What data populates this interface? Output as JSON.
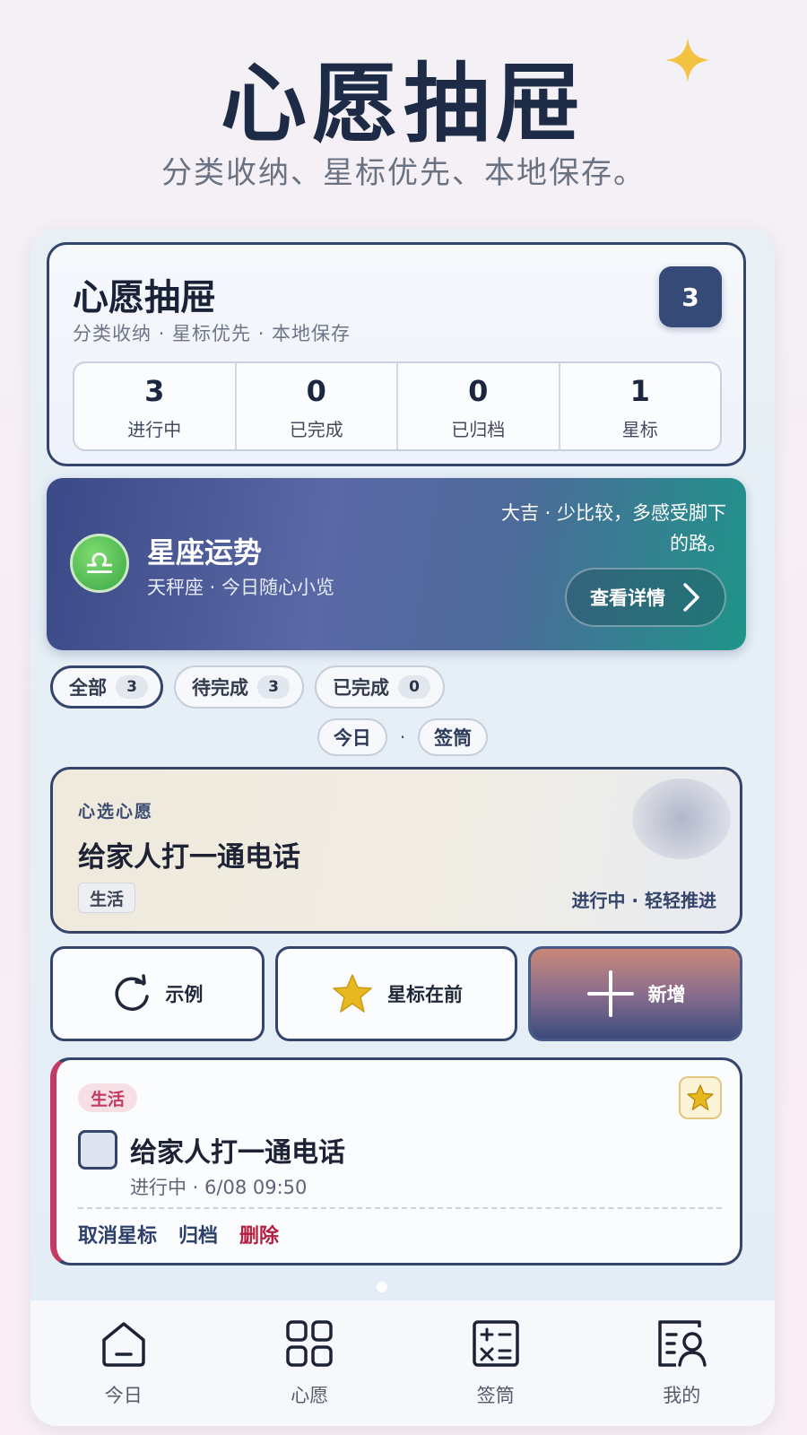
{
  "hero": {
    "title": "心愿抽屉",
    "subtitle": "分类收纳、星标优先、本地保存。"
  },
  "summary": {
    "title": "心愿抽屉",
    "subtitle": "分类收纳 · 星标优先 · 本地保存",
    "badge": "3",
    "stats": [
      {
        "value": "3",
        "label": "进行中"
      },
      {
        "value": "0",
        "label": "已完成"
      },
      {
        "value": "0",
        "label": "已归档"
      },
      {
        "value": "1",
        "label": "星标"
      }
    ]
  },
  "horoscope": {
    "icon": "libra-icon",
    "symbol": "♎",
    "title": "星座运势",
    "subtitle": "天秤座 · 今日随心小览",
    "message": "大吉 · 少比较，多感受脚下的路。",
    "button": "查看详情"
  },
  "filters": [
    {
      "label": "全部",
      "count": "3"
    },
    {
      "label": "待完成",
      "count": "3"
    },
    {
      "label": "已完成",
      "count": "0"
    }
  ],
  "subtabs": {
    "today": "今日",
    "separator": "·",
    "lots": "签筒"
  },
  "featured": {
    "label": "心选心愿",
    "title": "给家人打一通电话",
    "tag": "生活",
    "status": "进行中 · 轻轻推进"
  },
  "actions": {
    "example": "示例",
    "star_first": "星标在前",
    "add": "新增"
  },
  "task": {
    "tag": "生活",
    "title": "给家人打一通电话",
    "meta": "进行中 · 6/08 09:50",
    "unstar": "取消星标",
    "archive": "归档",
    "delete": "删除"
  },
  "tabbar": [
    {
      "label": "今日",
      "icon": "home-icon"
    },
    {
      "label": "心愿",
      "icon": "grid-icon"
    },
    {
      "label": "签筒",
      "icon": "calculator-icon"
    },
    {
      "label": "我的",
      "icon": "profile-icon"
    }
  ],
  "colors": {
    "navy": "#34446b",
    "accent_red": "#c33b63",
    "star_gold": "#e8b820"
  }
}
